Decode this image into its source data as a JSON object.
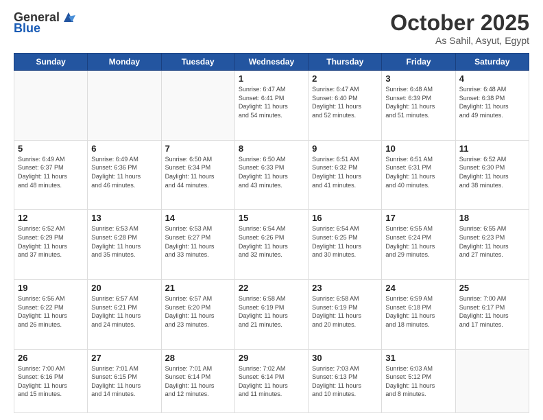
{
  "header": {
    "logo_general": "General",
    "logo_blue": "Blue",
    "month_title": "October 2025",
    "subtitle": "As Sahil, Asyut, Egypt"
  },
  "days_of_week": [
    "Sunday",
    "Monday",
    "Tuesday",
    "Wednesday",
    "Thursday",
    "Friday",
    "Saturday"
  ],
  "weeks": [
    [
      {
        "day": "",
        "info": ""
      },
      {
        "day": "",
        "info": ""
      },
      {
        "day": "",
        "info": ""
      },
      {
        "day": "1",
        "info": "Sunrise: 6:47 AM\nSunset: 6:41 PM\nDaylight: 11 hours\nand 54 minutes."
      },
      {
        "day": "2",
        "info": "Sunrise: 6:47 AM\nSunset: 6:40 PM\nDaylight: 11 hours\nand 52 minutes."
      },
      {
        "day": "3",
        "info": "Sunrise: 6:48 AM\nSunset: 6:39 PM\nDaylight: 11 hours\nand 51 minutes."
      },
      {
        "day": "4",
        "info": "Sunrise: 6:48 AM\nSunset: 6:38 PM\nDaylight: 11 hours\nand 49 minutes."
      }
    ],
    [
      {
        "day": "5",
        "info": "Sunrise: 6:49 AM\nSunset: 6:37 PM\nDaylight: 11 hours\nand 48 minutes."
      },
      {
        "day": "6",
        "info": "Sunrise: 6:49 AM\nSunset: 6:36 PM\nDaylight: 11 hours\nand 46 minutes."
      },
      {
        "day": "7",
        "info": "Sunrise: 6:50 AM\nSunset: 6:34 PM\nDaylight: 11 hours\nand 44 minutes."
      },
      {
        "day": "8",
        "info": "Sunrise: 6:50 AM\nSunset: 6:33 PM\nDaylight: 11 hours\nand 43 minutes."
      },
      {
        "day": "9",
        "info": "Sunrise: 6:51 AM\nSunset: 6:32 PM\nDaylight: 11 hours\nand 41 minutes."
      },
      {
        "day": "10",
        "info": "Sunrise: 6:51 AM\nSunset: 6:31 PM\nDaylight: 11 hours\nand 40 minutes."
      },
      {
        "day": "11",
        "info": "Sunrise: 6:52 AM\nSunset: 6:30 PM\nDaylight: 11 hours\nand 38 minutes."
      }
    ],
    [
      {
        "day": "12",
        "info": "Sunrise: 6:52 AM\nSunset: 6:29 PM\nDaylight: 11 hours\nand 37 minutes."
      },
      {
        "day": "13",
        "info": "Sunrise: 6:53 AM\nSunset: 6:28 PM\nDaylight: 11 hours\nand 35 minutes."
      },
      {
        "day": "14",
        "info": "Sunrise: 6:53 AM\nSunset: 6:27 PM\nDaylight: 11 hours\nand 33 minutes."
      },
      {
        "day": "15",
        "info": "Sunrise: 6:54 AM\nSunset: 6:26 PM\nDaylight: 11 hours\nand 32 minutes."
      },
      {
        "day": "16",
        "info": "Sunrise: 6:54 AM\nSunset: 6:25 PM\nDaylight: 11 hours\nand 30 minutes."
      },
      {
        "day": "17",
        "info": "Sunrise: 6:55 AM\nSunset: 6:24 PM\nDaylight: 11 hours\nand 29 minutes."
      },
      {
        "day": "18",
        "info": "Sunrise: 6:55 AM\nSunset: 6:23 PM\nDaylight: 11 hours\nand 27 minutes."
      }
    ],
    [
      {
        "day": "19",
        "info": "Sunrise: 6:56 AM\nSunset: 6:22 PM\nDaylight: 11 hours\nand 26 minutes."
      },
      {
        "day": "20",
        "info": "Sunrise: 6:57 AM\nSunset: 6:21 PM\nDaylight: 11 hours\nand 24 minutes."
      },
      {
        "day": "21",
        "info": "Sunrise: 6:57 AM\nSunset: 6:20 PM\nDaylight: 11 hours\nand 23 minutes."
      },
      {
        "day": "22",
        "info": "Sunrise: 6:58 AM\nSunset: 6:19 PM\nDaylight: 11 hours\nand 21 minutes."
      },
      {
        "day": "23",
        "info": "Sunrise: 6:58 AM\nSunset: 6:19 PM\nDaylight: 11 hours\nand 20 minutes."
      },
      {
        "day": "24",
        "info": "Sunrise: 6:59 AM\nSunset: 6:18 PM\nDaylight: 11 hours\nand 18 minutes."
      },
      {
        "day": "25",
        "info": "Sunrise: 7:00 AM\nSunset: 6:17 PM\nDaylight: 11 hours\nand 17 minutes."
      }
    ],
    [
      {
        "day": "26",
        "info": "Sunrise: 7:00 AM\nSunset: 6:16 PM\nDaylight: 11 hours\nand 15 minutes."
      },
      {
        "day": "27",
        "info": "Sunrise: 7:01 AM\nSunset: 6:15 PM\nDaylight: 11 hours\nand 14 minutes."
      },
      {
        "day": "28",
        "info": "Sunrise: 7:01 AM\nSunset: 6:14 PM\nDaylight: 11 hours\nand 12 minutes."
      },
      {
        "day": "29",
        "info": "Sunrise: 7:02 AM\nSunset: 6:14 PM\nDaylight: 11 hours\nand 11 minutes."
      },
      {
        "day": "30",
        "info": "Sunrise: 7:03 AM\nSunset: 6:13 PM\nDaylight: 11 hours\nand 10 minutes."
      },
      {
        "day": "31",
        "info": "Sunrise: 6:03 AM\nSunset: 5:12 PM\nDaylight: 11 hours\nand 8 minutes."
      },
      {
        "day": "",
        "info": ""
      }
    ]
  ]
}
